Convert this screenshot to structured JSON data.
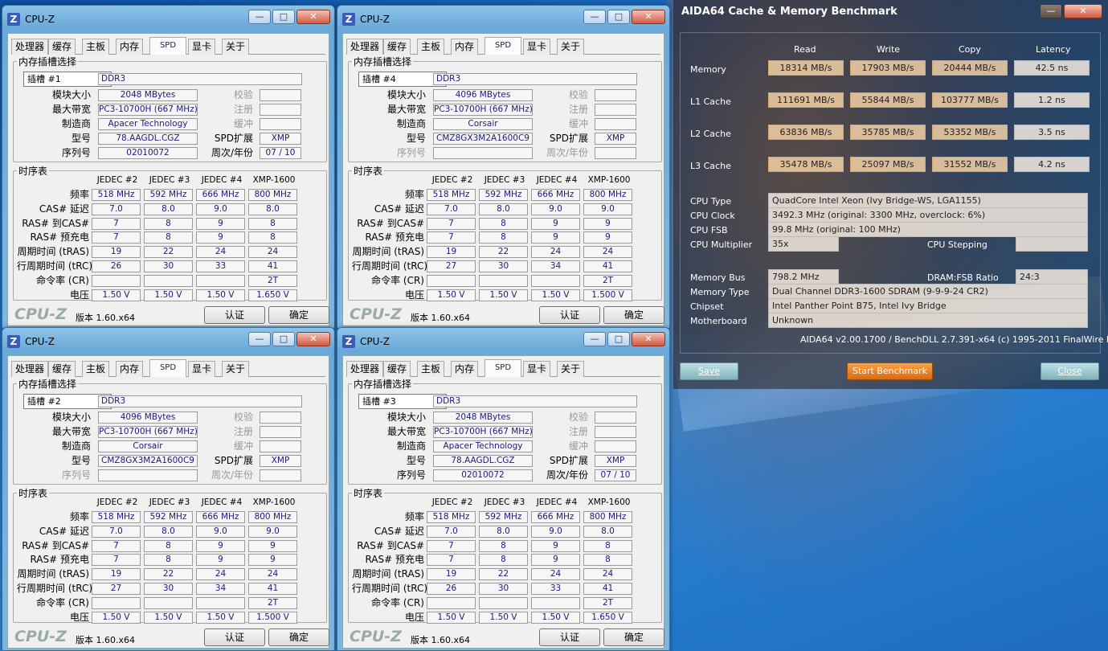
{
  "ui": {
    "app": "CPU-Z",
    "tabs": [
      "处理器",
      "缓存",
      "主板",
      "内存",
      "SPD",
      "显卡",
      "关于"
    ],
    "g_slot": "内存插槽选择",
    "g_timing": "时序表",
    "l_size": "模块大小",
    "l_bw": "最大带宽",
    "l_mfr": "制造商",
    "l_part": "型号",
    "l_serial": "序列号",
    "l_check": "校验",
    "l_reg": "注册",
    "l_buf": "缓冲",
    "l_spdext": "SPD扩展",
    "l_week": "周次/年份",
    "cols": [
      "JEDEC #2",
      "JEDEC #3",
      "JEDEC #4",
      "XMP-1600"
    ],
    "rows": [
      "频率",
      "CAS# 延迟",
      "RAS# 到CAS#",
      "RAS# 预充电",
      "周期时间 (tRAS)",
      "行周期时间 (tRC)",
      "命令率 (CR)",
      "电压"
    ],
    "brand": "CPU-Z",
    "ver": "版本 1.60.x64",
    "b_validate": "认证",
    "b_ok": "确定"
  },
  "windows": [
    {
      "slot": "插槽 #1",
      "type": "DDR3",
      "size": "2048 MBytes",
      "bw": "PC3-10700H (667 MHz)",
      "mfr": "Apacer Technology",
      "part": "78.AAGDL.CGZ",
      "spdext": "XMP",
      "serial": "02010072",
      "week": "07 / 10",
      "t": [
        [
          "518 MHz",
          "592 MHz",
          "666 MHz",
          "800 MHz"
        ],
        [
          "7.0",
          "8.0",
          "9.0",
          "8.0"
        ],
        [
          "7",
          "8",
          "9",
          "8"
        ],
        [
          "7",
          "8",
          "9",
          "8"
        ],
        [
          "19",
          "22",
          "24",
          "24"
        ],
        [
          "26",
          "30",
          "33",
          "41"
        ],
        [
          "",
          "",
          "",
          "2T"
        ],
        [
          "1.50 V",
          "1.50 V",
          "1.50 V",
          "1.650 V"
        ]
      ]
    },
    {
      "slot": "插槽 #4",
      "type": "DDR3",
      "size": "4096 MBytes",
      "bw": "PC3-10700H (667 MHz)",
      "mfr": "Corsair",
      "part": "CMZ8GX3M2A1600C9",
      "spdext": "XMP",
      "serial": "",
      "week": "",
      "t": [
        [
          "518 MHz",
          "592 MHz",
          "666 MHz",
          "800 MHz"
        ],
        [
          "7.0",
          "8.0",
          "9.0",
          "9.0"
        ],
        [
          "7",
          "8",
          "9",
          "9"
        ],
        [
          "7",
          "8",
          "9",
          "9"
        ],
        [
          "19",
          "22",
          "24",
          "24"
        ],
        [
          "27",
          "30",
          "34",
          "41"
        ],
        [
          "",
          "",
          "",
          "2T"
        ],
        [
          "1.50 V",
          "1.50 V",
          "1.50 V",
          "1.500 V"
        ]
      ]
    },
    {
      "slot": "插槽 #2",
      "type": "DDR3",
      "size": "4096 MBytes",
      "bw": "PC3-10700H (667 MHz)",
      "mfr": "Corsair",
      "part": "CMZ8GX3M2A1600C9",
      "spdext": "XMP",
      "serial": "",
      "week": "",
      "t": [
        [
          "518 MHz",
          "592 MHz",
          "666 MHz",
          "800 MHz"
        ],
        [
          "7.0",
          "8.0",
          "9.0",
          "9.0"
        ],
        [
          "7",
          "8",
          "9",
          "9"
        ],
        [
          "7",
          "8",
          "9",
          "9"
        ],
        [
          "19",
          "22",
          "24",
          "24"
        ],
        [
          "27",
          "30",
          "34",
          "41"
        ],
        [
          "",
          "",
          "",
          "2T"
        ],
        [
          "1.50 V",
          "1.50 V",
          "1.50 V",
          "1.500 V"
        ]
      ]
    },
    {
      "slot": "插槽 #3",
      "type": "DDR3",
      "size": "2048 MBytes",
      "bw": "PC3-10700H (667 MHz)",
      "mfr": "Apacer Technology",
      "part": "78.AAGDL.CGZ",
      "spdext": "XMP",
      "serial": "02010072",
      "week": "07 / 10",
      "t": [
        [
          "518 MHz",
          "592 MHz",
          "666 MHz",
          "800 MHz"
        ],
        [
          "7.0",
          "8.0",
          "9.0",
          "8.0"
        ],
        [
          "7",
          "8",
          "9",
          "8"
        ],
        [
          "7",
          "8",
          "9",
          "8"
        ],
        [
          "19",
          "22",
          "24",
          "24"
        ],
        [
          "26",
          "30",
          "33",
          "41"
        ],
        [
          "",
          "",
          "",
          "2T"
        ],
        [
          "1.50 V",
          "1.50 V",
          "1.50 V",
          "1.650 V"
        ]
      ]
    }
  ],
  "aida": {
    "title": "AIDA64 Cache & Memory Benchmark",
    "cols": [
      "Read",
      "Write",
      "Copy",
      "Latency"
    ],
    "rows": [
      [
        "Memory",
        "18314 MB/s",
        "17903 MB/s",
        "20444 MB/s",
        "42.5 ns"
      ],
      [
        "L1 Cache",
        "111691 MB/s",
        "55844 MB/s",
        "103777 MB/s",
        "1.2 ns"
      ],
      [
        "L2 Cache",
        "63836 MB/s",
        "35785 MB/s",
        "53352 MB/s",
        "3.5 ns"
      ],
      [
        "L3 Cache",
        "35478 MB/s",
        "25097 MB/s",
        "31552 MB/s",
        "4.2 ns"
      ]
    ],
    "cpu_type_l": "CPU Type",
    "cpu_type": "QuadCore Intel Xeon  (Ivy Bridge-WS, LGA1155)",
    "cpu_clock_l": "CPU Clock",
    "cpu_clock": "3492.3 MHz  (original: 3300 MHz, overclock: 6%)",
    "cpu_fsb_l": "CPU FSB",
    "cpu_fsb": "99.8 MHz  (original: 100 MHz)",
    "cpu_mult_l": "CPU Multiplier",
    "cpu_mult": "35x",
    "cpu_step_l": "CPU Stepping",
    "cpu_step": "",
    "mem_bus_l": "Memory Bus",
    "mem_bus": "798.2 MHz",
    "ratio_l": "DRAM:FSB Ratio",
    "ratio": "24:3",
    "mem_type_l": "Memory Type",
    "mem_type": "Dual Channel DDR3-1600 SDRAM  (9-9-9-24 CR2)",
    "chipset_l": "Chipset",
    "chipset": "Intel Panther Point B75, Intel Ivy Bridge",
    "mobo_l": "Motherboard",
    "mobo": "Unknown",
    "footer": "AIDA64 v2.00.1700 / BenchDLL 2.7.391-x64  (c) 1995-2011 FinalWire Ltd.",
    "save": "Save",
    "start": "Start Benchmark",
    "close": "Close"
  }
}
